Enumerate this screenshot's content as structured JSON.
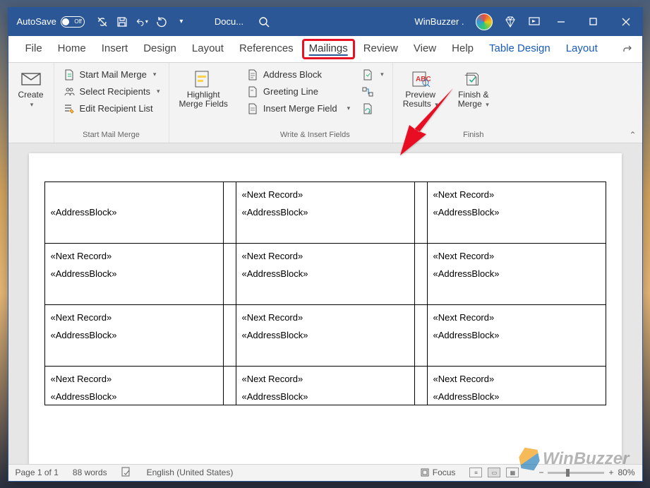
{
  "titlebar": {
    "autosave_label": "AutoSave",
    "autosave_state": "Off",
    "doc_name": "Docu...",
    "app_title": "WinBuzzer ."
  },
  "tabs": {
    "file": "File",
    "home": "Home",
    "insert": "Insert",
    "design": "Design",
    "layout": "Layout",
    "references": "References",
    "mailings": "Mailings",
    "review": "Review",
    "view": "View",
    "help": "Help",
    "table_design": "Table Design",
    "layout2": "Layout"
  },
  "ribbon": {
    "create": {
      "label": "Create"
    },
    "start_merge_group": {
      "start": "Start Mail Merge",
      "select": "Select Recipients",
      "edit": "Edit Recipient List",
      "group_label": "Start Mail Merge"
    },
    "highlight": {
      "label1": "Highlight",
      "label2": "Merge Fields"
    },
    "write_group": {
      "address_block": "Address Block",
      "greeting_line": "Greeting Line",
      "insert_merge": "Insert Merge Field",
      "group_label": "Write & Insert Fields"
    },
    "preview": {
      "label1": "Preview",
      "label2": "Results"
    },
    "finish": {
      "label1": "Finish &",
      "label2": "Merge",
      "group_label": "Finish"
    }
  },
  "doc": {
    "next_record": "«Next Record»",
    "address_block": "«AddressBlock»"
  },
  "statusbar": {
    "page": "Page 1 of 1",
    "words": "88 words",
    "lang": "English (United States)",
    "focus": "Focus",
    "zoom": "80%"
  },
  "watermark": "WinBuzzer"
}
